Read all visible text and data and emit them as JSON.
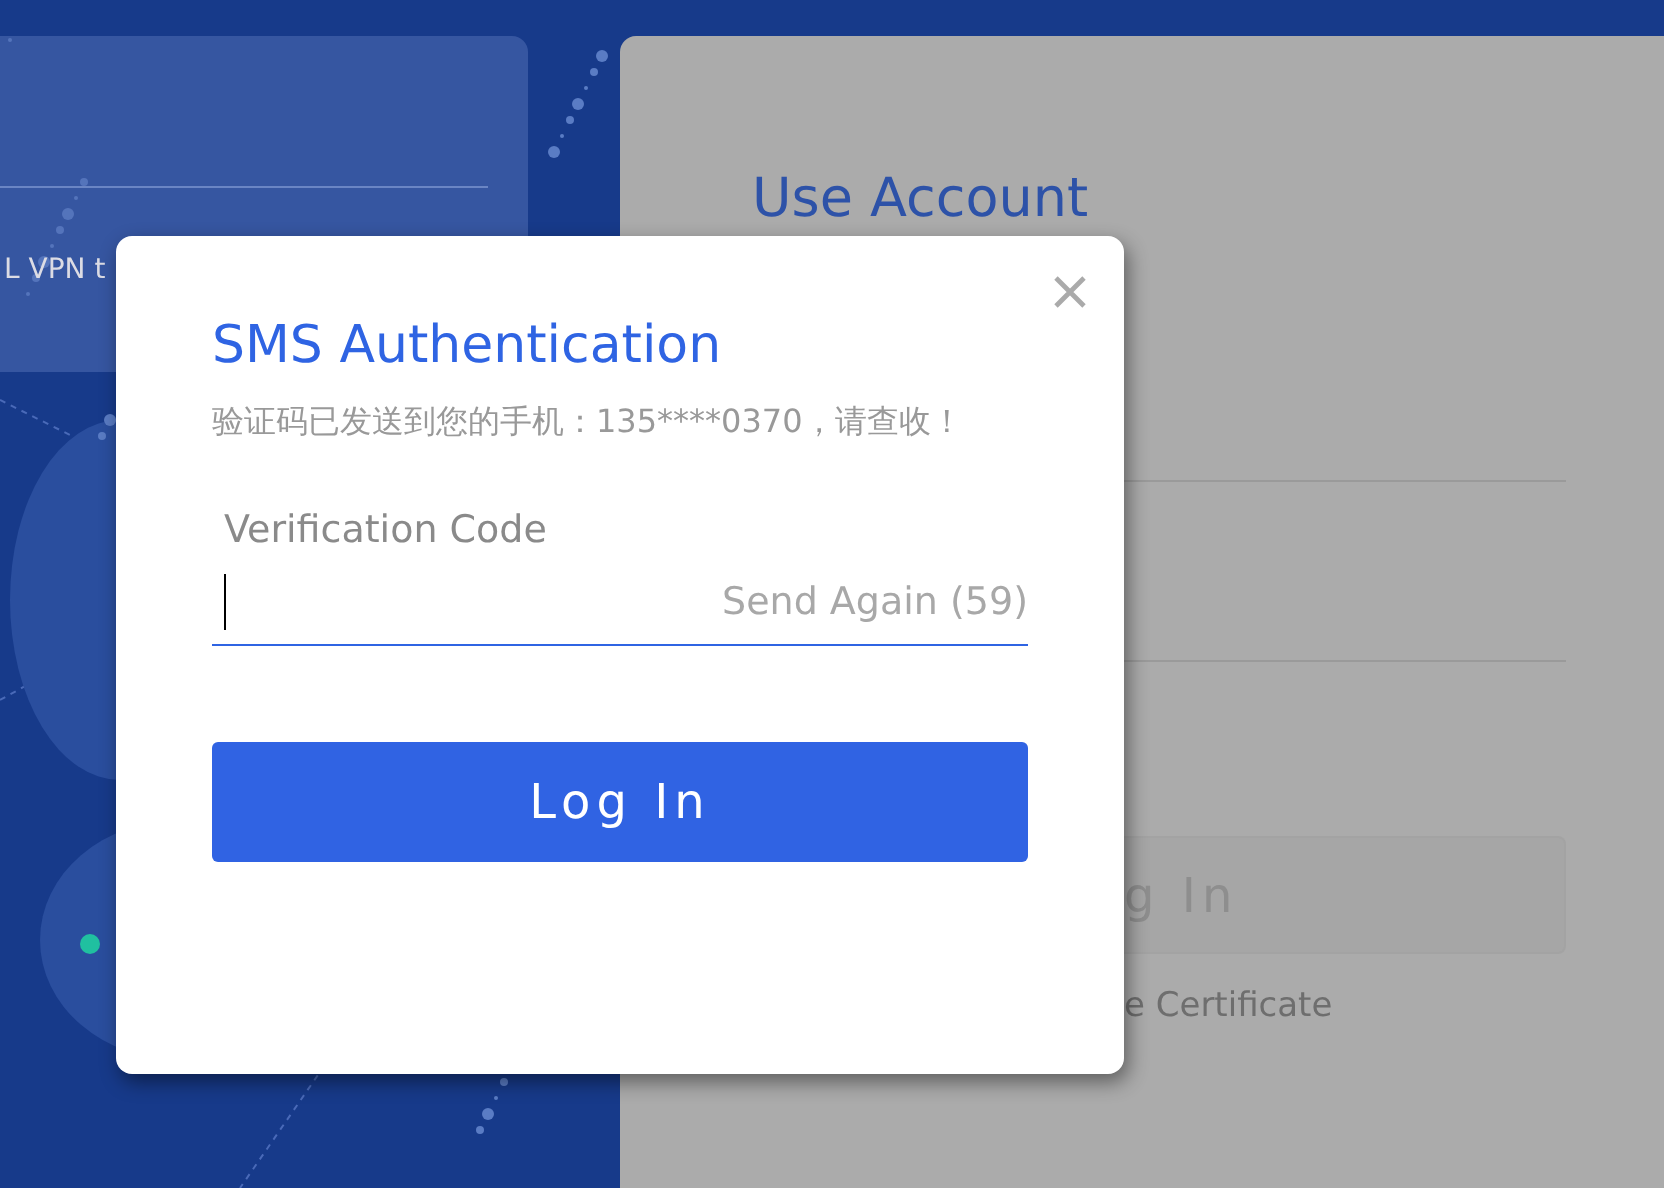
{
  "background_card": {
    "text": "L VPN t"
  },
  "login_panel": {
    "title": "Use Account",
    "login_button": "g In",
    "certificate_link": "e Certificate"
  },
  "dialog": {
    "title": "SMS Authentication",
    "message": "验证码已发送到您的手机：135****0370，请查收！",
    "field": {
      "label": "Verification Code",
      "focused": true
    },
    "resend": {
      "label": "Send Again (59)",
      "disabled": true
    },
    "submit": "Log In"
  }
}
